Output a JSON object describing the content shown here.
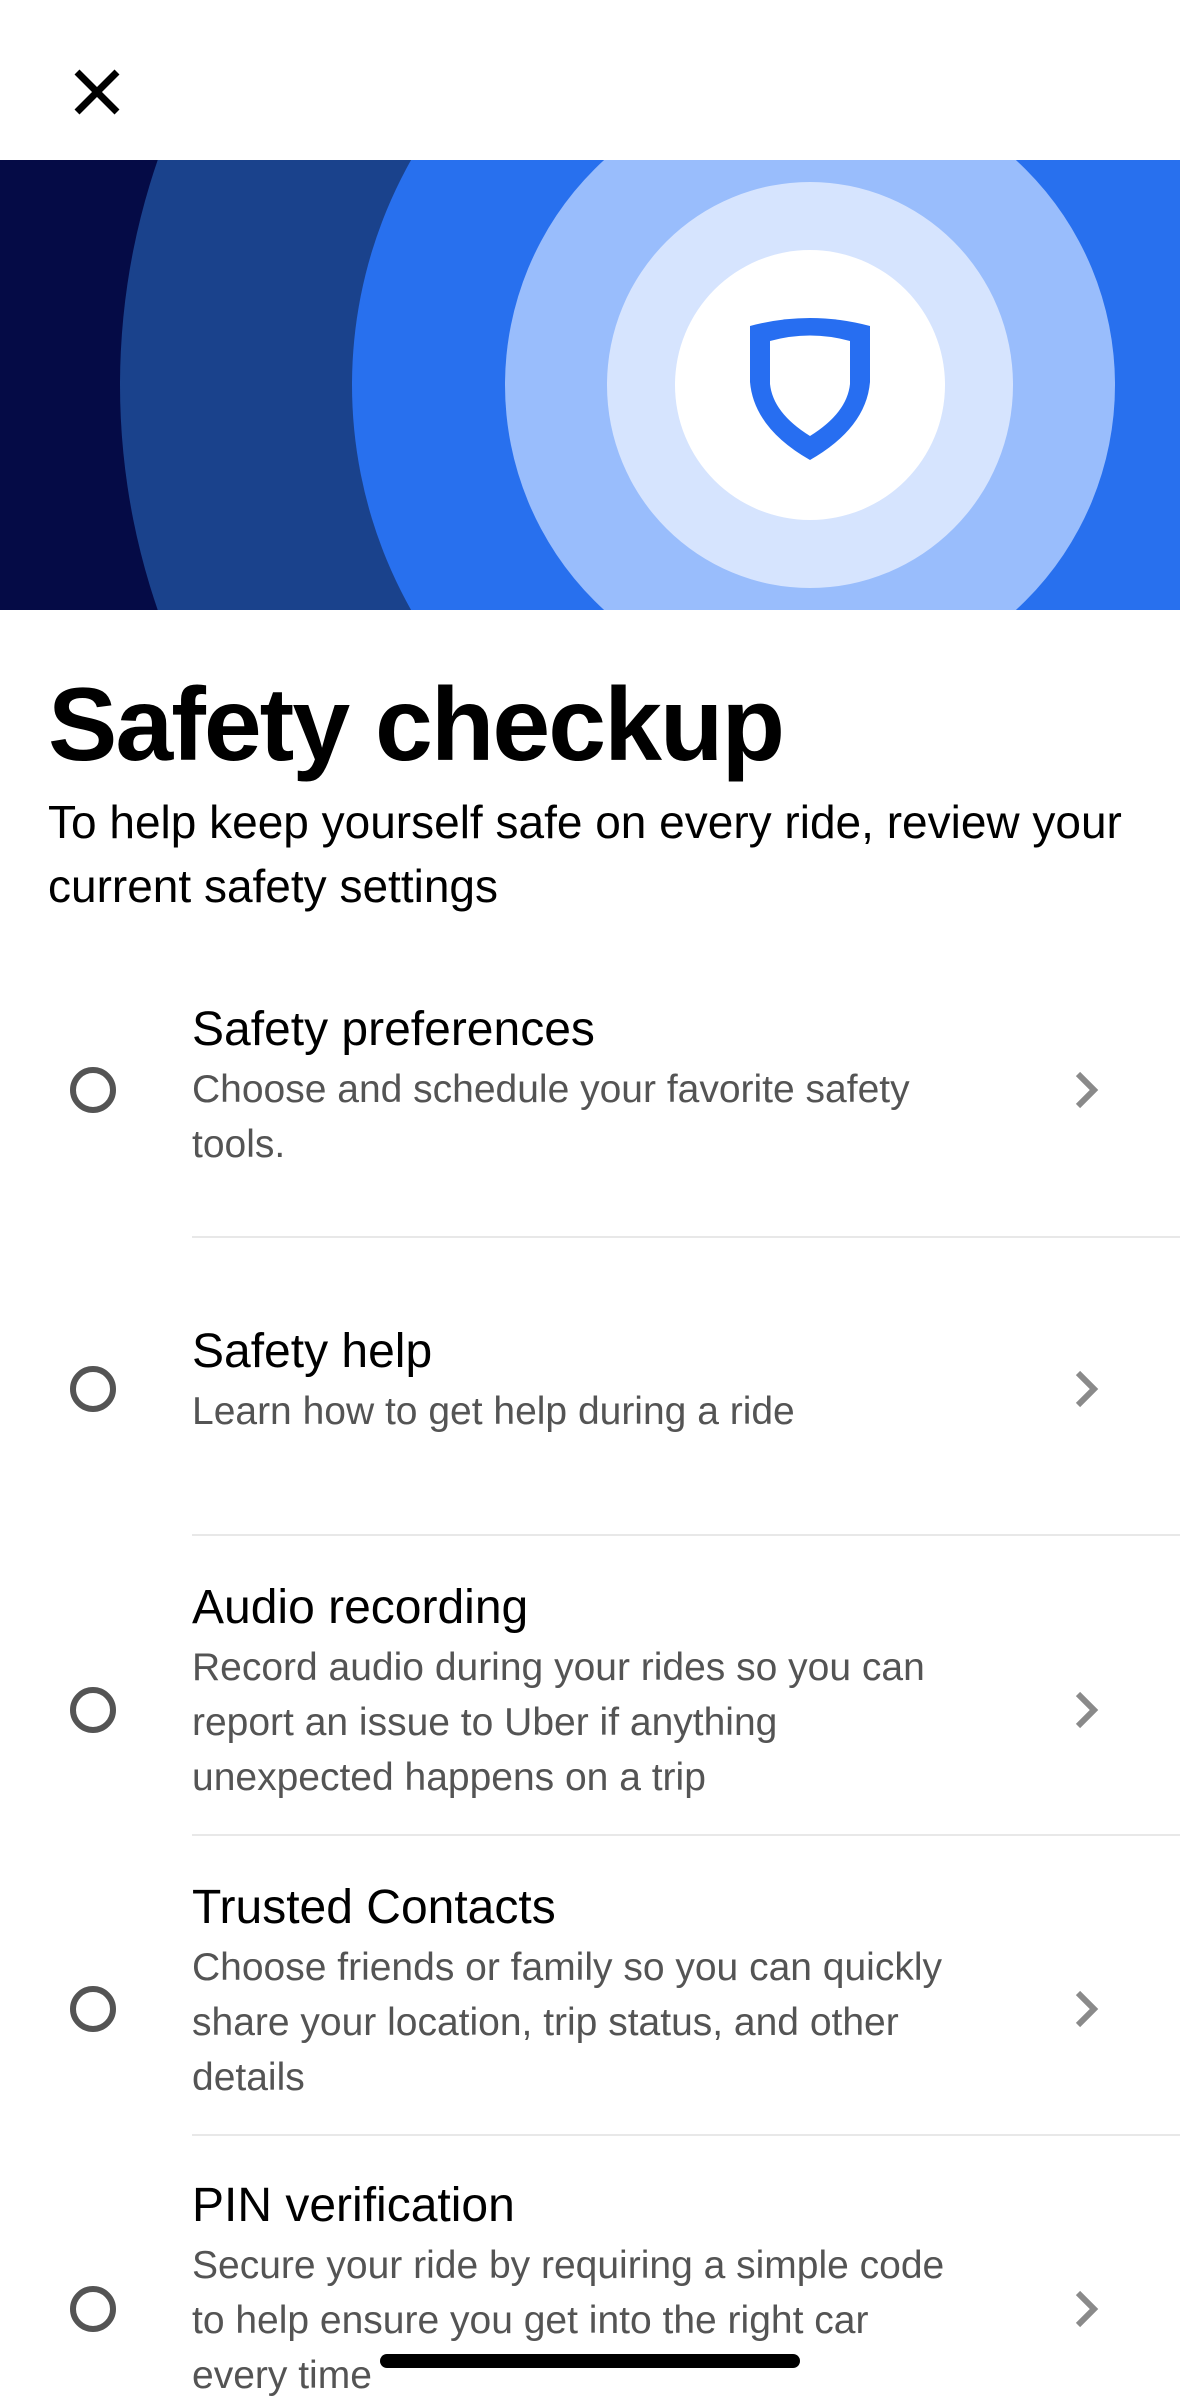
{
  "header": {
    "close_icon": "close-icon"
  },
  "hero": {
    "icon": "shield-icon",
    "colors": {
      "ring1": "#050b46",
      "ring2": "#1a428c",
      "ring3": "#2870ee",
      "ring4": "#99bdfc",
      "ring5": "#d6e4fe",
      "center": "#ffffff",
      "shield": "#276ef1"
    }
  },
  "page": {
    "title": "Safety checkup",
    "subtitle": "To help keep yourself safe on every ride, review your current safety settings"
  },
  "items": [
    {
      "title": "Safety preferences",
      "description": "Choose and schedule your favorite safety tools.",
      "checked": false
    },
    {
      "title": "Safety help",
      "description": "Learn how to get help during a ride",
      "checked": false
    },
    {
      "title": "Audio recording",
      "description": "Record audio during your rides so you can report an issue to Uber if anything unexpected happens on a trip",
      "checked": false
    },
    {
      "title": "Trusted Contacts",
      "description": "Choose friends or family so you can quickly share your location, trip status, and other details",
      "checked": false
    },
    {
      "title": "PIN verification",
      "description": "Secure your ride by requiring a simple code to help ensure you get into the right car every time",
      "checked": false
    }
  ]
}
